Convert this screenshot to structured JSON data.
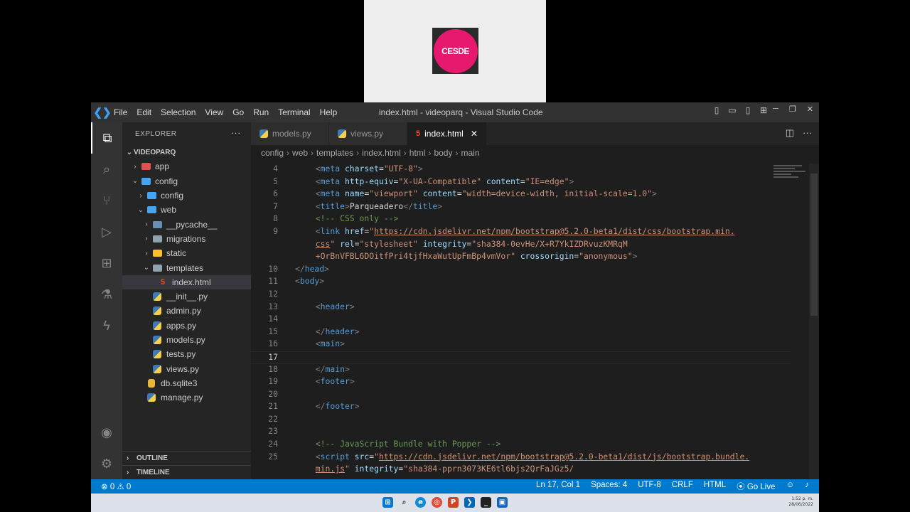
{
  "webcam": {
    "logo_text": "CESDE"
  },
  "titlebar": {
    "menu": [
      "File",
      "Edit",
      "Selection",
      "View",
      "Go",
      "Run",
      "Terminal",
      "Help"
    ],
    "title": "index.html - videoparq - Visual Studio Code"
  },
  "sidebar": {
    "header": "EXPLORER",
    "project": "VIDEOPARQ",
    "tree": [
      {
        "label": "app",
        "depth": 1,
        "chev": "›",
        "icon": "folder-app-icon",
        "color": "#e05252"
      },
      {
        "label": "config",
        "depth": 1,
        "chev": "⌄",
        "icon": "folder-config-icon",
        "color": "#42a5f5"
      },
      {
        "label": "config",
        "depth": 2,
        "chev": "›",
        "icon": "folder-config-icon",
        "color": "#42a5f5"
      },
      {
        "label": "web",
        "depth": 2,
        "chev": "⌄",
        "icon": "folder-web-icon",
        "color": "#42a5f5"
      },
      {
        "label": "__pycache__",
        "depth": 3,
        "chev": "›",
        "icon": "folder-pycache-icon",
        "color": "#6a8fb5"
      },
      {
        "label": "migrations",
        "depth": 3,
        "chev": "›",
        "icon": "folder-icon",
        "color": "#90a4ae"
      },
      {
        "label": "static",
        "depth": 3,
        "chev": "›",
        "icon": "folder-static-icon",
        "color": "#fbc02d"
      },
      {
        "label": "templates",
        "depth": 3,
        "chev": "⌄",
        "icon": "folder-templates-icon",
        "color": "#90a4ae"
      },
      {
        "label": "index.html",
        "depth": 4,
        "chev": "",
        "icon": "html-file-icon",
        "selected": true
      },
      {
        "label": "__init__.py",
        "depth": 3,
        "chev": "",
        "icon": "python-file-icon"
      },
      {
        "label": "admin.py",
        "depth": 3,
        "chev": "",
        "icon": "python-file-icon"
      },
      {
        "label": "apps.py",
        "depth": 3,
        "chev": "",
        "icon": "python-file-icon"
      },
      {
        "label": "models.py",
        "depth": 3,
        "chev": "",
        "icon": "python-file-icon"
      },
      {
        "label": "tests.py",
        "depth": 3,
        "chev": "",
        "icon": "python-file-icon"
      },
      {
        "label": "views.py",
        "depth": 3,
        "chev": "",
        "icon": "python-file-icon"
      },
      {
        "label": "db.sqlite3",
        "depth": 2,
        "chev": "",
        "icon": "database-file-icon"
      },
      {
        "label": "manage.py",
        "depth": 2,
        "chev": "",
        "icon": "python-file-icon"
      }
    ],
    "outline": "OUTLINE",
    "timeline": "TIMELINE"
  },
  "tabs": [
    {
      "label": "models.py",
      "icon": "python-file-icon",
      "active": false
    },
    {
      "label": "views.py",
      "icon": "python-file-icon",
      "active": false
    },
    {
      "label": "index.html",
      "icon": "html-file-icon",
      "active": true
    }
  ],
  "breadcrumb": [
    "config",
    "web",
    "templates",
    "index.html",
    "html",
    "body",
    "main"
  ],
  "code": {
    "current_line": "17",
    "lines": [
      {
        "n": "4",
        "indent": 8,
        "parts": [
          [
            "tag",
            "<"
          ],
          [
            "tn",
            "meta"
          ],
          [
            "tx",
            " "
          ],
          [
            "an",
            "charset"
          ],
          [
            "tx",
            "="
          ],
          [
            "av",
            "\"UTF-8\""
          ],
          [
            "tag",
            ">"
          ]
        ]
      },
      {
        "n": "5",
        "indent": 8,
        "parts": [
          [
            "tag",
            "<"
          ],
          [
            "tn",
            "meta"
          ],
          [
            "tx",
            " "
          ],
          [
            "an",
            "http-equiv"
          ],
          [
            "tx",
            "="
          ],
          [
            "av",
            "\"X-UA-Compatible\""
          ],
          [
            "tx",
            " "
          ],
          [
            "an",
            "content"
          ],
          [
            "tx",
            "="
          ],
          [
            "av",
            "\"IE=edge\""
          ],
          [
            "tag",
            ">"
          ]
        ]
      },
      {
        "n": "6",
        "indent": 8,
        "parts": [
          [
            "tag",
            "<"
          ],
          [
            "tn",
            "meta"
          ],
          [
            "tx",
            " "
          ],
          [
            "an",
            "name"
          ],
          [
            "tx",
            "="
          ],
          [
            "av",
            "\"viewport\""
          ],
          [
            "tx",
            " "
          ],
          [
            "an",
            "content"
          ],
          [
            "tx",
            "="
          ],
          [
            "av",
            "\"width=device-width, initial-scale=1.0\""
          ],
          [
            "tag",
            ">"
          ]
        ]
      },
      {
        "n": "7",
        "indent": 8,
        "parts": [
          [
            "tag",
            "<"
          ],
          [
            "tn",
            "title"
          ],
          [
            "tag",
            ">"
          ],
          [
            "tx",
            "Parqueadero"
          ],
          [
            "tag",
            "</"
          ],
          [
            "tn",
            "title"
          ],
          [
            "tag",
            ">"
          ]
        ]
      },
      {
        "n": "8",
        "indent": 8,
        "parts": [
          [
            "cm",
            "<!-- CSS only -->"
          ]
        ]
      },
      {
        "n": "9",
        "indent": 8,
        "parts": [
          [
            "tag",
            "<"
          ],
          [
            "tn",
            "link"
          ],
          [
            "tx",
            " "
          ],
          [
            "an",
            "href"
          ],
          [
            "tx",
            "="
          ],
          [
            "av",
            "\""
          ],
          [
            "url",
            "https://cdn.jsdelivr.net/npm/bootstrap@5.2.0-beta1/dist/css/bootstrap.min."
          ]
        ]
      },
      {
        "n": "",
        "indent": 8,
        "parts": [
          [
            "url",
            "css"
          ],
          [
            "av",
            "\""
          ],
          [
            "tx",
            " "
          ],
          [
            "an",
            "rel"
          ],
          [
            "tx",
            "="
          ],
          [
            "av",
            "\"stylesheet\""
          ],
          [
            "tx",
            " "
          ],
          [
            "an",
            "integrity"
          ],
          [
            "tx",
            "="
          ],
          [
            "av",
            "\"sha384-0evHe/X+R7YkIZDRvuzKMRqM"
          ]
        ]
      },
      {
        "n": "",
        "indent": 8,
        "parts": [
          [
            "av",
            "+OrBnVFBL6DOitfPri4tjfHxaWutUpFmBp4vmVor\""
          ],
          [
            "tx",
            " "
          ],
          [
            "an",
            "crossorigin"
          ],
          [
            "tx",
            "="
          ],
          [
            "av",
            "\"anonymous\""
          ],
          [
            "tag",
            ">"
          ]
        ]
      },
      {
        "n": "10",
        "indent": 0,
        "parts": [
          [
            "tag",
            "</"
          ],
          [
            "tn",
            "head"
          ],
          [
            "tag",
            ">"
          ]
        ]
      },
      {
        "n": "11",
        "indent": 0,
        "parts": [
          [
            "tag",
            "<"
          ],
          [
            "tn",
            "body"
          ],
          [
            "tag",
            ">"
          ]
        ]
      },
      {
        "n": "12",
        "indent": 0,
        "parts": []
      },
      {
        "n": "13",
        "indent": 8,
        "parts": [
          [
            "tag",
            "<"
          ],
          [
            "tn",
            "header"
          ],
          [
            "tag",
            ">"
          ]
        ]
      },
      {
        "n": "14",
        "indent": 0,
        "parts": []
      },
      {
        "n": "15",
        "indent": 8,
        "parts": [
          [
            "tag",
            "</"
          ],
          [
            "tn",
            "header"
          ],
          [
            "tag",
            ">"
          ]
        ]
      },
      {
        "n": "16",
        "indent": 8,
        "parts": [
          [
            "tag",
            "<"
          ],
          [
            "tn",
            "main"
          ],
          [
            "tag",
            ">"
          ]
        ]
      },
      {
        "n": "17",
        "indent": 0,
        "parts": [],
        "current": true
      },
      {
        "n": "18",
        "indent": 8,
        "parts": [
          [
            "tag",
            "</"
          ],
          [
            "tn",
            "main"
          ],
          [
            "tag",
            ">"
          ]
        ]
      },
      {
        "n": "19",
        "indent": 8,
        "parts": [
          [
            "tag",
            "<"
          ],
          [
            "tn",
            "footer"
          ],
          [
            "tag",
            ">"
          ]
        ]
      },
      {
        "n": "20",
        "indent": 0,
        "parts": []
      },
      {
        "n": "21",
        "indent": 8,
        "parts": [
          [
            "tag",
            "</"
          ],
          [
            "tn",
            "footer"
          ],
          [
            "tag",
            ">"
          ]
        ]
      },
      {
        "n": "22",
        "indent": 0,
        "parts": []
      },
      {
        "n": "23",
        "indent": 0,
        "parts": []
      },
      {
        "n": "24",
        "indent": 8,
        "parts": [
          [
            "cm",
            "<!-- JavaScript Bundle with Popper -->"
          ]
        ]
      },
      {
        "n": "25",
        "indent": 8,
        "parts": [
          [
            "tag",
            "<"
          ],
          [
            "tn",
            "script"
          ],
          [
            "tx",
            " "
          ],
          [
            "an",
            "src"
          ],
          [
            "tx",
            "="
          ],
          [
            "av",
            "\""
          ],
          [
            "url",
            "https://cdn.jsdelivr.net/npm/bootstrap@5.2.0-beta1/dist/js/bootstrap.bundle."
          ]
        ]
      },
      {
        "n": "",
        "indent": 8,
        "parts": [
          [
            "url",
            "min.js"
          ],
          [
            "av",
            "\""
          ],
          [
            "tx",
            " "
          ],
          [
            "an",
            "integrity"
          ],
          [
            "tx",
            "="
          ],
          [
            "av",
            "\"sha384-pprn3073KE6tl6bjs2QrFaJGz5/"
          ]
        ]
      }
    ]
  },
  "statusbar": {
    "problems": "⊗ 0 ⚠ 0",
    "position": "Ln 17, Col 1",
    "spaces": "Spaces: 4",
    "encoding": "UTF-8",
    "eol": "CRLF",
    "language": "HTML",
    "golive": "Go Live"
  },
  "colors": {
    "accent": "#007acc",
    "brand": "#e6196e"
  }
}
